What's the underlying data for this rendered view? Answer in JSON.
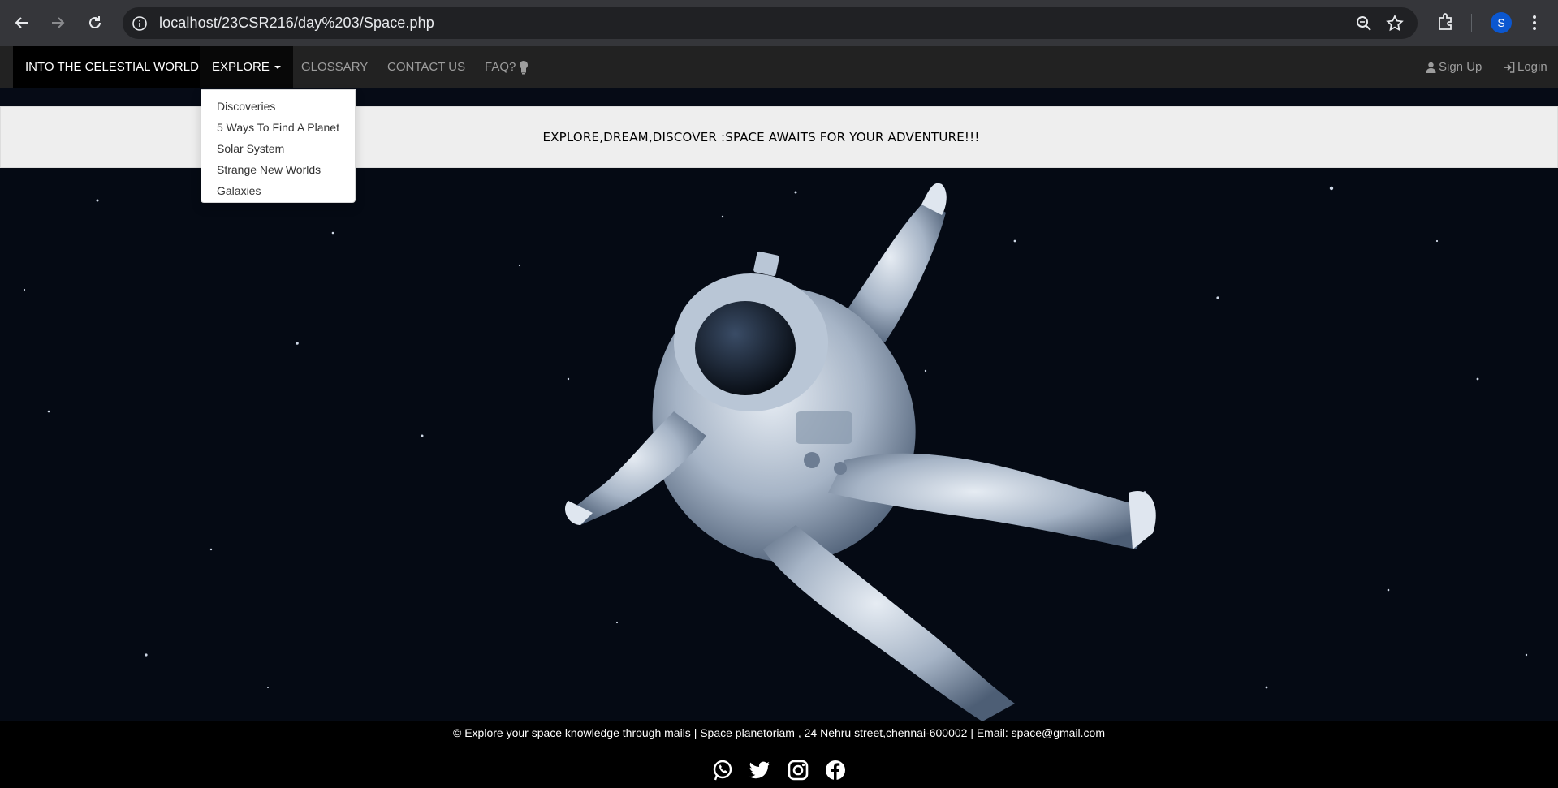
{
  "browser": {
    "url": "localhost/23CSR216/day%203/Space.php",
    "profile_initial": "S"
  },
  "navbar": {
    "brand": "INTO THE CELESTIAL WORLD",
    "explore": "EXPLORE",
    "glossary": "GLOSSARY",
    "contact": "CONTACT US",
    "faq": "FAQ?",
    "signup": "Sign Up",
    "login": "Login"
  },
  "dropdown": {
    "items": [
      "Discoveries",
      "5 Ways To Find A Planet",
      "Solar System",
      "Strange New Worlds",
      "Galaxies"
    ]
  },
  "banner": {
    "text": "EXPLORE,DREAM,DISCOVER :SPACE AWAITS FOR YOUR ADVENTURE!!!"
  },
  "footer": {
    "text": "© Explore your space knowledge through mails | Space planetoriam , 24 Nehru street,chennai-600002 | Email: space@gmail.com",
    "icons": [
      "whatsapp-icon",
      "twitter-icon",
      "instagram-icon",
      "facebook-icon"
    ]
  },
  "colors": {
    "chrome_bg": "#35363a",
    "navbar_bg": "#222222",
    "banner_bg": "#eeeeee",
    "space_bg": "#050a14",
    "footer_bg": "#000000"
  }
}
